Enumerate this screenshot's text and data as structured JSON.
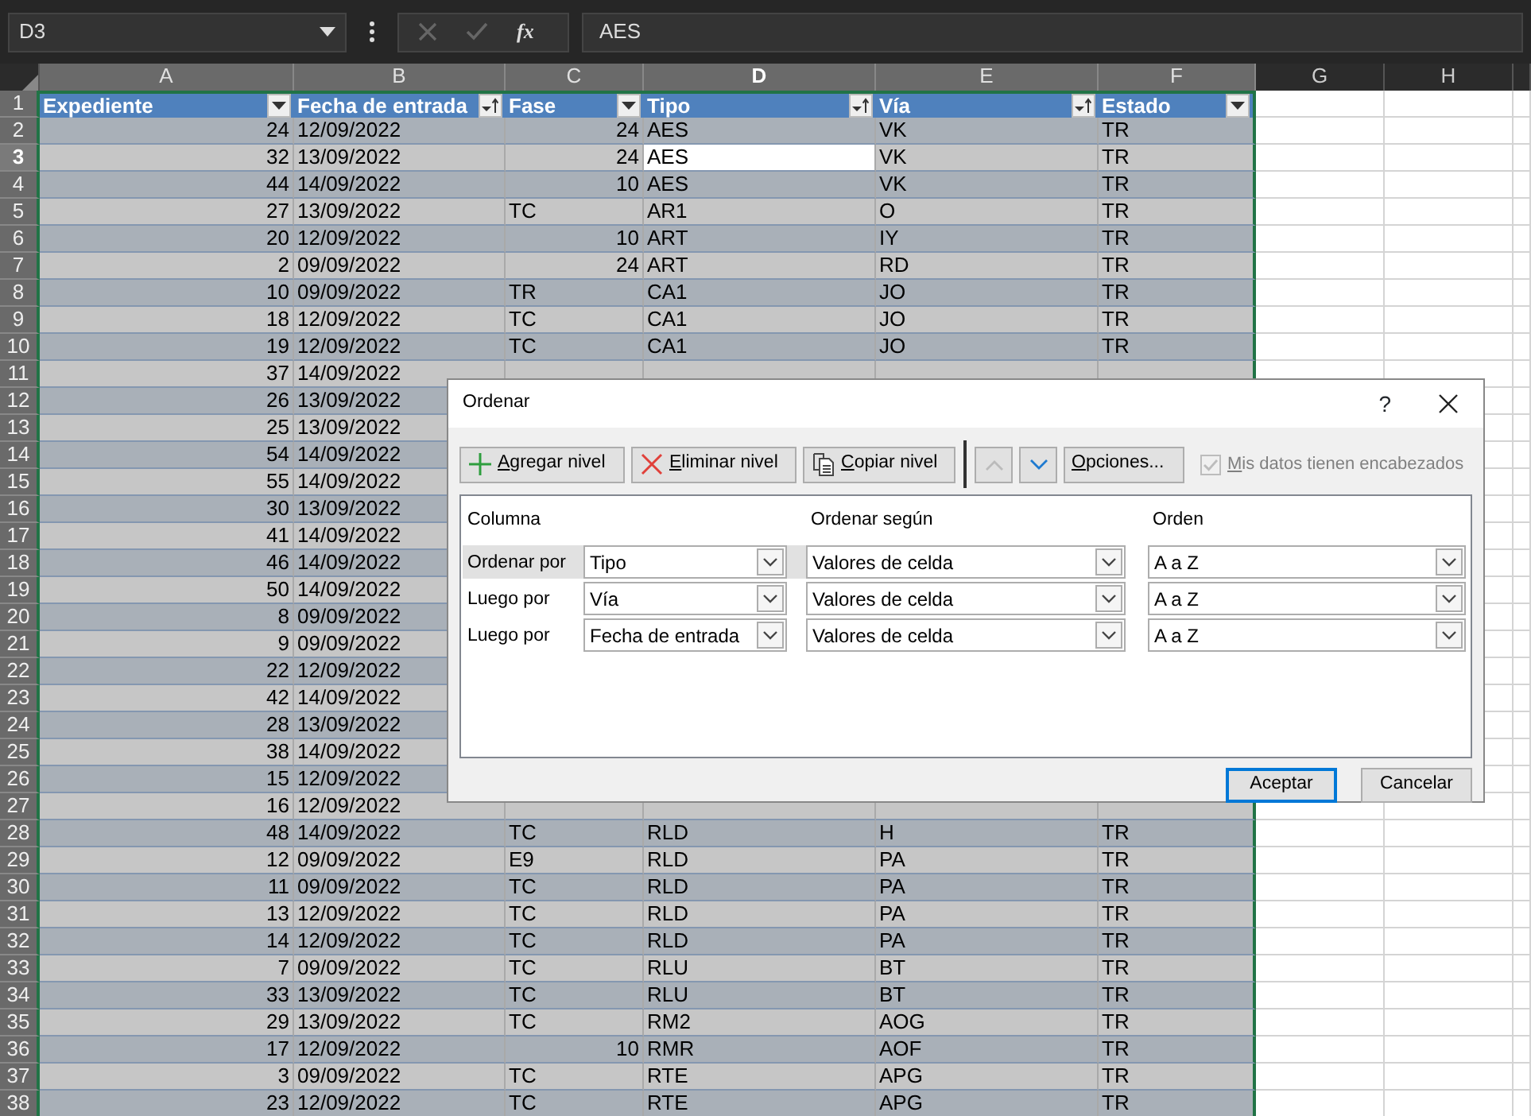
{
  "formula_bar": {
    "name_box": "D3",
    "function_button": "fx",
    "formula": "AES"
  },
  "sheet": {
    "column_letters": [
      {
        "letter": "A",
        "active": false
      },
      {
        "letter": "B",
        "active": false
      },
      {
        "letter": "C",
        "active": false
      },
      {
        "letter": "D",
        "active": true
      },
      {
        "letter": "E",
        "active": false
      },
      {
        "letter": "F",
        "active": false
      },
      {
        "letter": "G",
        "active": false
      },
      {
        "letter": "H",
        "active": false
      }
    ],
    "header_row_number": "1",
    "table_headers": [
      {
        "label": "Expediente",
        "sorted": false
      },
      {
        "label": "Fecha de entrada",
        "sorted": true
      },
      {
        "label": "Fase",
        "sorted": false
      },
      {
        "label": "Tipo",
        "sorted": true
      },
      {
        "label": "Vía",
        "sorted": true
      },
      {
        "label": "Estado",
        "sorted": false
      }
    ],
    "rows": [
      {
        "number": "2",
        "active": false,
        "cells": [
          "24",
          "12/09/2022",
          "24",
          "AES",
          "VK",
          "TR"
        ]
      },
      {
        "number": "3",
        "active": true,
        "cells": [
          "32",
          "13/09/2022",
          "24",
          "AES",
          "VK",
          "TR"
        ]
      },
      {
        "number": "4",
        "active": false,
        "cells": [
          "44",
          "14/09/2022",
          "10",
          "AES",
          "VK",
          "TR"
        ]
      },
      {
        "number": "5",
        "active": false,
        "cells": [
          "27",
          "13/09/2022",
          "TC",
          "AR1",
          "O",
          "TR"
        ]
      },
      {
        "number": "6",
        "active": false,
        "cells": [
          "20",
          "12/09/2022",
          "10",
          "ART",
          "IY",
          "TR"
        ]
      },
      {
        "number": "7",
        "active": false,
        "cells": [
          "2",
          "09/09/2022",
          "24",
          "ART",
          "RD",
          "TR"
        ]
      },
      {
        "number": "8",
        "active": false,
        "cells": [
          "10",
          "09/09/2022",
          "TR",
          "CA1",
          "JO",
          "TR"
        ]
      },
      {
        "number": "9",
        "active": false,
        "cells": [
          "18",
          "12/09/2022",
          "TC",
          "CA1",
          "JO",
          "TR"
        ]
      },
      {
        "number": "10",
        "active": false,
        "cells": [
          "19",
          "12/09/2022",
          "TC",
          "CA1",
          "JO",
          "TR"
        ]
      },
      {
        "number": "11",
        "active": false,
        "cells": [
          "37",
          "14/09/2022"
        ]
      },
      {
        "number": "12",
        "active": false,
        "cells": [
          "26",
          "13/09/2022"
        ]
      },
      {
        "number": "13",
        "active": false,
        "cells": [
          "25",
          "13/09/2022"
        ]
      },
      {
        "number": "14",
        "active": false,
        "cells": [
          "54",
          "14/09/2022"
        ]
      },
      {
        "number": "15",
        "active": false,
        "cells": [
          "55",
          "14/09/2022"
        ]
      },
      {
        "number": "16",
        "active": false,
        "cells": [
          "30",
          "13/09/2022"
        ]
      },
      {
        "number": "17",
        "active": false,
        "cells": [
          "41",
          "14/09/2022"
        ]
      },
      {
        "number": "18",
        "active": false,
        "cells": [
          "46",
          "14/09/2022"
        ]
      },
      {
        "number": "19",
        "active": false,
        "cells": [
          "50",
          "14/09/2022"
        ]
      },
      {
        "number": "20",
        "active": false,
        "cells": [
          "8",
          "09/09/2022"
        ]
      },
      {
        "number": "21",
        "active": false,
        "cells": [
          "9",
          "09/09/2022"
        ]
      },
      {
        "number": "22",
        "active": false,
        "cells": [
          "22",
          "12/09/2022"
        ]
      },
      {
        "number": "23",
        "active": false,
        "cells": [
          "42",
          "14/09/2022"
        ]
      },
      {
        "number": "24",
        "active": false,
        "cells": [
          "28",
          "13/09/2022"
        ]
      },
      {
        "number": "25",
        "active": false,
        "cells": [
          "38",
          "14/09/2022"
        ]
      },
      {
        "number": "26",
        "active": false,
        "cells": [
          "15",
          "12/09/2022"
        ]
      },
      {
        "number": "27",
        "active": false,
        "cells": [
          "16",
          "12/09/2022"
        ]
      },
      {
        "number": "28",
        "active": false,
        "cells": [
          "48",
          "14/09/2022",
          "TC",
          "RLD",
          "H",
          "TR"
        ]
      },
      {
        "number": "29",
        "active": false,
        "cells": [
          "12",
          "09/09/2022",
          "E9",
          "RLD",
          "PA",
          "TR"
        ]
      },
      {
        "number": "30",
        "active": false,
        "cells": [
          "11",
          "09/09/2022",
          "TC",
          "RLD",
          "PA",
          "TR"
        ]
      },
      {
        "number": "31",
        "active": false,
        "cells": [
          "13",
          "12/09/2022",
          "TC",
          "RLD",
          "PA",
          "TR"
        ]
      },
      {
        "number": "32",
        "active": false,
        "cells": [
          "14",
          "12/09/2022",
          "TC",
          "RLD",
          "PA",
          "TR"
        ]
      },
      {
        "number": "33",
        "active": false,
        "cells": [
          "7",
          "09/09/2022",
          "TC",
          "RLU",
          "BT",
          "TR"
        ]
      },
      {
        "number": "34",
        "active": false,
        "cells": [
          "33",
          "13/09/2022",
          "TC",
          "RLU",
          "BT",
          "TR"
        ]
      },
      {
        "number": "35",
        "active": false,
        "cells": [
          "29",
          "13/09/2022",
          "TC",
          "RM2",
          "AOG",
          "TR"
        ]
      },
      {
        "number": "36",
        "active": false,
        "cells": [
          "17",
          "12/09/2022",
          "10",
          "RMR",
          "AOF",
          "TR"
        ]
      },
      {
        "number": "37",
        "active": false,
        "cells": [
          "3",
          "09/09/2022",
          "TC",
          "RTE",
          "APG",
          "TR"
        ]
      },
      {
        "number": "38",
        "active": false,
        "cells": [
          "23",
          "12/09/2022",
          "TC",
          "RTE",
          "APG",
          "TR"
        ]
      }
    ]
  },
  "sort_dialog": {
    "title": "Ordenar",
    "help": "?",
    "toolbar": [
      {
        "kind": "add",
        "label": "Agregar nivel",
        "mnemonic": true
      },
      {
        "kind": "delete",
        "label": "Eliminar nivel",
        "mnemonic": true
      },
      {
        "kind": "copy",
        "label": "Copiar nivel",
        "mnemonic": true
      }
    ],
    "move_up": {
      "disabled": true
    },
    "move_down": {
      "disabled": false
    },
    "options": {
      "label": "Opciones...",
      "mnemonic": true
    },
    "headers_checkbox": {
      "label": "Mis datos tienen encabezados",
      "checked": true,
      "disabled": true,
      "mnemonic": true
    },
    "columns": [
      "Columna",
      "Ordenar según",
      "Orden"
    ],
    "levels": [
      {
        "label": "Ordenar por",
        "column": "Tipo",
        "sort_on": "Valores de celda",
        "order": "A a Z",
        "selected": true
      },
      {
        "label": "Luego por",
        "column": "Vía",
        "sort_on": "Valores de celda",
        "order": "A a Z",
        "selected": false
      },
      {
        "label": "Luego por",
        "column": "Fecha de entrada",
        "sort_on": "Valores de celda",
        "order": "A a Z",
        "selected": false
      }
    ],
    "buttons": [
      {
        "label": "Aceptar",
        "default": true
      },
      {
        "label": "Cancelar",
        "default": false
      }
    ]
  }
}
